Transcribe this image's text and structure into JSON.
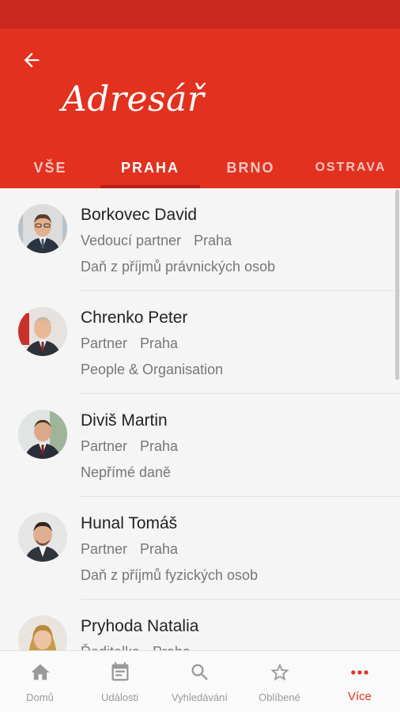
{
  "header": {
    "title": "Adresář"
  },
  "tabs": [
    {
      "label": "VŠE"
    },
    {
      "label": "PRAHA"
    },
    {
      "label": "BRNO"
    },
    {
      "label": "OSTRAVA"
    }
  ],
  "active_tab": "PRAHA",
  "contacts": [
    {
      "name": "Borkovec David",
      "role": "Vedoucí partner",
      "city": "Praha",
      "dept": "Daň z příjmů právnických osob"
    },
    {
      "name": "Chrenko Peter",
      "role": "Partner",
      "city": "Praha",
      "dept": "People & Organisation"
    },
    {
      "name": "Diviš Martin",
      "role": "Partner",
      "city": "Praha",
      "dept": "Nepřímé daně"
    },
    {
      "name": "Hunal Tomáš",
      "role": "Partner",
      "city": "Praha",
      "dept": "Daň z příjmů fyzických osob"
    },
    {
      "name": "Pryhoda Natalia",
      "role": "Ředitelka",
      "city": "Praha",
      "dept": ""
    }
  ],
  "bottom_nav": [
    {
      "label": "Domů",
      "icon": "home-icon"
    },
    {
      "label": "Události",
      "icon": "calendar-icon"
    },
    {
      "label": "Vyhledávání",
      "icon": "search-icon"
    },
    {
      "label": "Oblíbené",
      "icon": "star-icon"
    },
    {
      "label": "Více",
      "icon": "more-icon"
    }
  ],
  "colors": {
    "primary": "#e2311f",
    "status_bar": "#c8281f",
    "tab_indicator": "#b8211a"
  }
}
